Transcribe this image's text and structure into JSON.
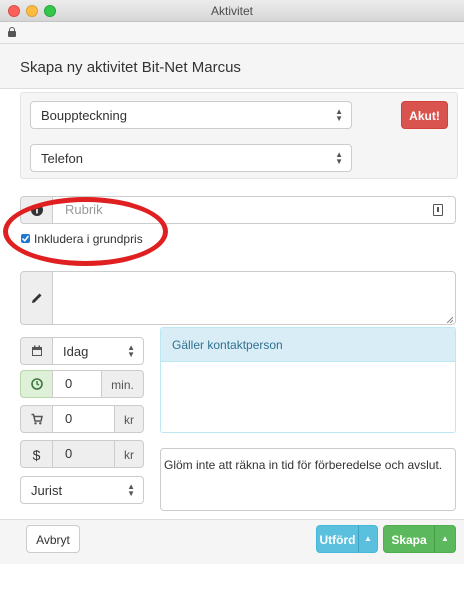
{
  "window": {
    "title": "Aktivitet"
  },
  "header": {
    "title": "Skapa ny aktivitet Bit-Net Marcus"
  },
  "type_select": {
    "value": "Bouppteckning"
  },
  "urgent_button": {
    "label": "Akut!"
  },
  "channel_select": {
    "value": "Telefon"
  },
  "subject": {
    "placeholder": "Rubrik"
  },
  "include_base_price": {
    "label": "Inkludera i grundpris",
    "checked": true
  },
  "notes": {
    "value": ""
  },
  "date_select": {
    "value": "Idag"
  },
  "time": {
    "value": "0",
    "unit": "min."
  },
  "cost": {
    "value": "0",
    "unit": "kr"
  },
  "price": {
    "value": "0",
    "unit": "kr"
  },
  "role_select": {
    "value": "Jurist"
  },
  "contact_panel": {
    "heading": "Gäller kontaktperson"
  },
  "reminder": {
    "text": "Glöm inte att räkna in tid för förberedelse och avslut."
  },
  "footer": {
    "cancel_label": "Avbryt",
    "done_label": "Utförd",
    "create_label": "Skapa"
  },
  "colors": {
    "danger": "#d9534f",
    "info": "#5bc0de",
    "success": "#5cb85c",
    "annotation": "#e02020"
  }
}
